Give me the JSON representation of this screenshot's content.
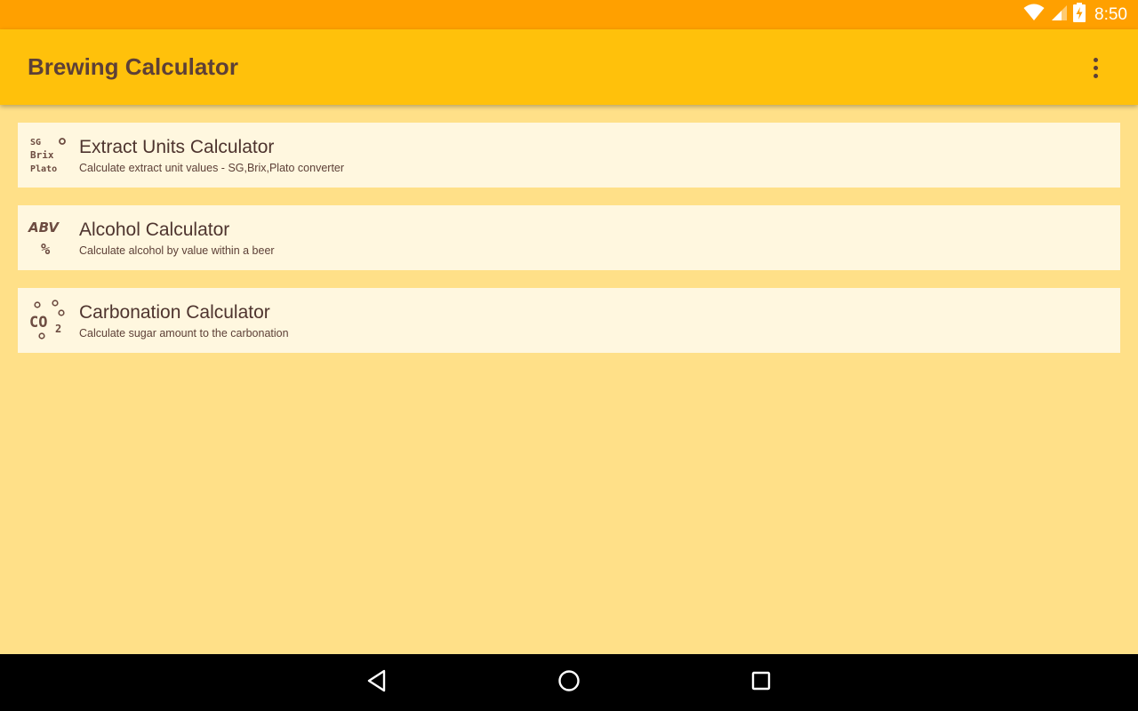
{
  "status_bar": {
    "time": "8:50",
    "icons": [
      "wifi-icon",
      "cell-signal-icon",
      "battery-charging-icon"
    ]
  },
  "app_bar": {
    "title": "Brewing Calculator",
    "overflow_icon": "more-vert-icon"
  },
  "calculators": [
    {
      "icon": "sg-brix-plato-icon",
      "icon_text": [
        "SG",
        "Brix",
        "Plato"
      ],
      "title": "Extract Units Calculator",
      "subtitle": "Calculate extract unit values - SG,Brix,Plato converter"
    },
    {
      "icon": "abv-percent-icon",
      "icon_text": [
        "ABV",
        "%"
      ],
      "title": "Alcohol Calculator",
      "subtitle": "Calculate alcohol by value within a beer"
    },
    {
      "icon": "co2-bubbles-icon",
      "icon_text": [
        "CO",
        "2"
      ],
      "title": "Carbonation Calculator",
      "subtitle": "Calculate sugar amount to the carbonation"
    }
  ],
  "nav_bar": {
    "buttons": [
      "back-icon",
      "home-icon",
      "recents-icon"
    ]
  },
  "colors": {
    "status_bar": "#FFA000",
    "app_bar": "#FFC10B",
    "background": "#FFE088",
    "card": "#FFF7DF",
    "text": "#5D4037",
    "nav_bar": "#000000"
  }
}
